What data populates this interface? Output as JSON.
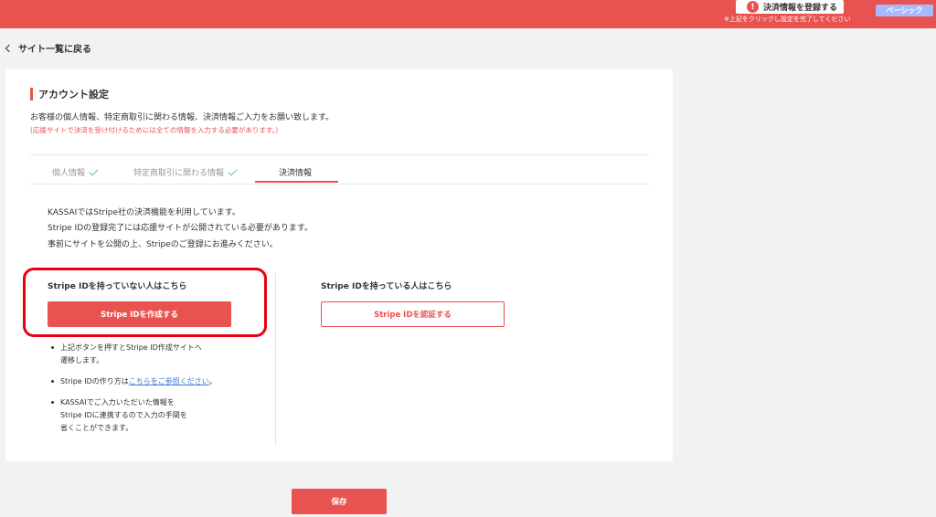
{
  "header": {
    "alert_button_label": "決済情報を登録する",
    "alert_icon": "!",
    "alert_note": "※上記をクリックし設定を完了してください",
    "plan_label": "ベーシック"
  },
  "back_link": "サイト一覧に戻る",
  "section": {
    "title": "アカウント設定",
    "intro": "お客様の個人情報、特定商取引に関わる情報、決済情報ご入力をお願い致します。",
    "note": "(応援サイトで決済を受け付けるためには全ての情報を入力する必要があります。)"
  },
  "tabs": [
    {
      "label": "個人情報",
      "done": true
    },
    {
      "label": "特定商取引に関わる情報",
      "done": true
    },
    {
      "label": "決済情報",
      "active": true
    }
  ],
  "description": [
    "KASSAIではStripe社の決済機能を利用しています。",
    "Stripe IDの登録完了には応援サイトが公開されている必要があります。",
    "事前にサイトを公開の上、Stripeのご登録にお進みください。"
  ],
  "no_id": {
    "heading": "Stripe IDを持っていない人はこちら",
    "button": "Stripe IDを作成する",
    "bullets": {
      "b1_line1": "上記ボタンを押すとStripe ID作成サイトへ",
      "b1_line2": "遷移します。",
      "b2_prefix": "Stripe IDの作り方は",
      "b2_link": "こちらをご参照ください",
      "b2_suffix": "。",
      "b3_line1": "KASSAIでご入力いただいた情報を",
      "b3_line2": "Stripe IDに連携するので入力の手間を",
      "b3_line3": "省くことができます。"
    }
  },
  "has_id": {
    "heading": "Stripe IDを持っている人はこちら",
    "button": "Stripe IDを認証する"
  },
  "save_label": "保存",
  "colors": {
    "accent": "#e8534f",
    "highlight": "#e60012",
    "check": "#6cc08b",
    "plan": "#a9b9ff",
    "link": "#3a7bd5"
  }
}
